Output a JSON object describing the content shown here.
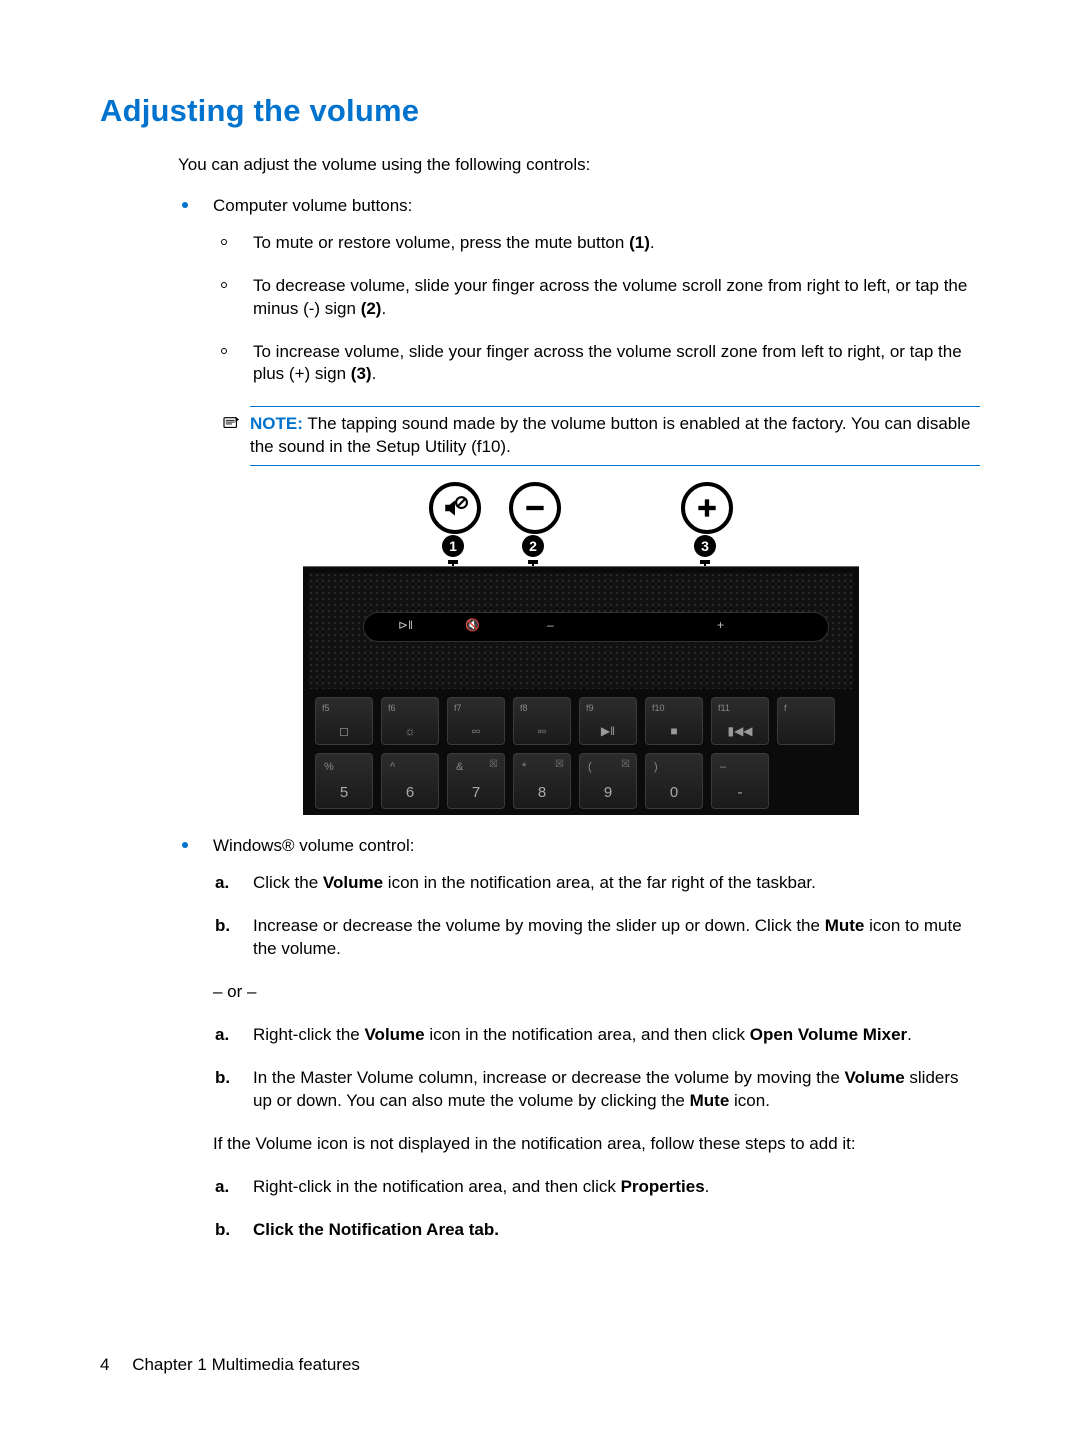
{
  "title": "Adjusting the volume",
  "intro": "You can adjust the volume using the following controls:",
  "bullet1": {
    "lead": "Computer volume buttons:",
    "subs": {
      "a": "To mute or restore volume, press the mute button ",
      "a_ref": "(1)",
      "a_tail": ".",
      "b": "To decrease volume, slide your finger across the volume scroll zone from right to left, or tap the minus (-) sign ",
      "b_ref": "(2)",
      "b_tail": ".",
      "c": "To increase volume, slide your finger across the volume scroll zone from left to right, or tap the plus (+) sign ",
      "c_ref": "(3)",
      "c_tail": "."
    },
    "note_label": "NOTE:",
    "note_text": "The tapping sound made by the volume button is enabled at the factory. You can disable the sound in the Setup Utility (f10)."
  },
  "figure": {
    "badges": [
      "1",
      "2",
      "3"
    ],
    "fkeys": [
      {
        "top": "f5",
        "sub": "◻"
      },
      {
        "top": "f6",
        "sub": "☼"
      },
      {
        "top": "f7",
        "sub": "▫▫"
      },
      {
        "top": "f8",
        "sub": "▫▫"
      },
      {
        "top": "f9",
        "sub": "▶‖"
      },
      {
        "top": "f10",
        "sub": "■"
      },
      {
        "top": "f11",
        "sub": "▮◀◀"
      },
      {
        "top": "f",
        "sub": ""
      }
    ],
    "numkeys": [
      {
        "top": "%",
        "sub": "5",
        "tr": ""
      },
      {
        "top": "^",
        "sub": "6",
        "tr": ""
      },
      {
        "top": "&",
        "sub": "7",
        "tr": "☒"
      },
      {
        "top": "*",
        "sub": "8",
        "tr": "☒"
      },
      {
        "top": "(",
        "sub": "9",
        "tr": "☒"
      },
      {
        "top": ")",
        "sub": "0",
        "tr": ""
      },
      {
        "top": "–",
        "sub": "-",
        "tr": ""
      }
    ],
    "strip_marks": {
      "left": "⊳‖",
      "mute": "🔇",
      "minus": "–",
      "plus": "+"
    }
  },
  "bullet2": {
    "lead": "Windows® volume control:",
    "first": {
      "a_pre": "Click the ",
      "a_b1": "Volume",
      "a_post": " icon in the notification area, at the far right of the taskbar.",
      "b_pre": "Increase or decrease the volume by moving the slider up or down. Click the ",
      "b_b1": "Mute",
      "b_post": " icon to mute the volume."
    },
    "or": "– or –",
    "second": {
      "a_pre": "Right-click the ",
      "a_b1": "Volume",
      "a_mid": " icon in the notification area, and then click ",
      "a_b2": "Open Volume Mixer",
      "a_post": ".",
      "b_pre": "In the Master Volume column, increase or decrease the volume by moving the ",
      "b_b1": "Volume",
      "b_mid": " sliders up or down. You can also mute the volume by clicking the ",
      "b_b2": "Mute",
      "b_post": " icon."
    },
    "follow": "If the Volume icon is not displayed in the notification area, follow these steps to add it:",
    "third": {
      "a_pre": "Right-click in the notification area, and then click ",
      "a_b1": "Properties",
      "a_post": ".",
      "b_pre": "Click the ",
      "b_b1": "Notification Area",
      "b_post": " tab."
    }
  },
  "footer": {
    "page": "4",
    "chapter": "Chapter 1   Multimedia features"
  }
}
